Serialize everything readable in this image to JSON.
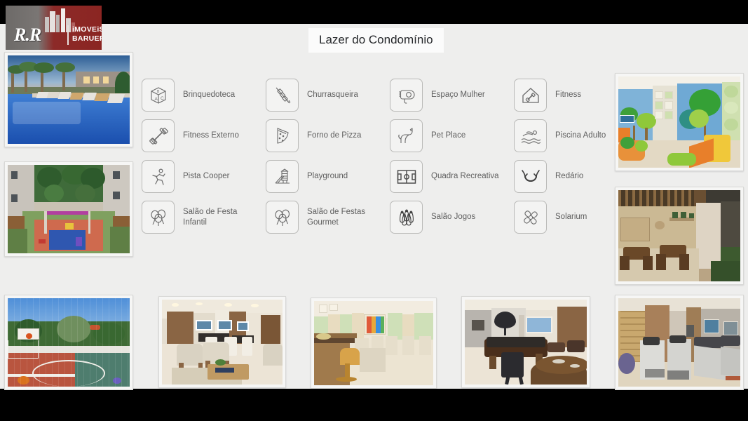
{
  "window": {
    "background_color": "#000000",
    "stage_color": "#eeeeed"
  },
  "logo": {
    "name": "R.R Imóveis Barueri",
    "initials": "R.R",
    "line1": "iMOVEiS",
    "line2": "BARUERI",
    "gray": "#6d6a68",
    "red": "#8b2522"
  },
  "header": {
    "title": "Lazer do Condomínio"
  },
  "amenities": [
    {
      "label": "Brinquedoteca",
      "icon": "toy-block-icon"
    },
    {
      "label": "Churrasqueira",
      "icon": "skewer-icon"
    },
    {
      "label": "Espaço Mulher",
      "icon": "hairdryer-icon"
    },
    {
      "label": "Fitness",
      "icon": "gym-house-icon"
    },
    {
      "label": "Fitness Externo",
      "icon": "dumbbell-icon"
    },
    {
      "label": "Forno de Pizza",
      "icon": "pizza-slice-icon"
    },
    {
      "label": "Pet Place",
      "icon": "dog-icon"
    },
    {
      "label": "Piscina Adulto",
      "icon": "swimmer-icon"
    },
    {
      "label": "Pista Cooper",
      "icon": "runner-icon"
    },
    {
      "label": "Playground",
      "icon": "playground-slide-icon"
    },
    {
      "label": "Quadra Recreativa",
      "icon": "sports-court-icon"
    },
    {
      "label": "Redário",
      "icon": "hammock-icon"
    },
    {
      "label": "Salão de Festa Infantil",
      "icon": "balloons-icon"
    },
    {
      "label": "Salão de Festas Gourmet",
      "icon": "balloons-icon"
    },
    {
      "label": "Salão Jogos",
      "icon": "bowling-pins-icon"
    },
    {
      "label": "Solarium",
      "icon": "sun-flower-icon"
    }
  ],
  "photos": [
    {
      "id": "photo-pool",
      "caption": "Piscina adulto com espreguiçadeiras e palmeiras ao entardecer"
    },
    {
      "id": "photo-playground",
      "caption": "Playground e área de convivência no pátio interno"
    },
    {
      "id": "photo-sports-court",
      "caption": "Quadra poliesportiva com cesta de basquete e alambrado"
    },
    {
      "id": "photo-kids-room",
      "caption": "Brinquedoteca infantil com painéis de árvores e escorregador"
    },
    {
      "id": "photo-bbq-pergola",
      "caption": "Espaço churrasqueira com pergolado e mesas de madeira"
    },
    {
      "id": "photo-lounge",
      "caption": "Salão de festas / lounge com poltronas e mesa de centro"
    },
    {
      "id": "photo-gourmet",
      "caption": "Salão de festas gourmet com bancada e banquetas"
    },
    {
      "id": "photo-games-room",
      "caption": "Salão de jogos com mesa de sinuca e mesa de carteado"
    },
    {
      "id": "photo-gym",
      "caption": "Academia com bicicletas ergométricas e esteiras"
    }
  ]
}
